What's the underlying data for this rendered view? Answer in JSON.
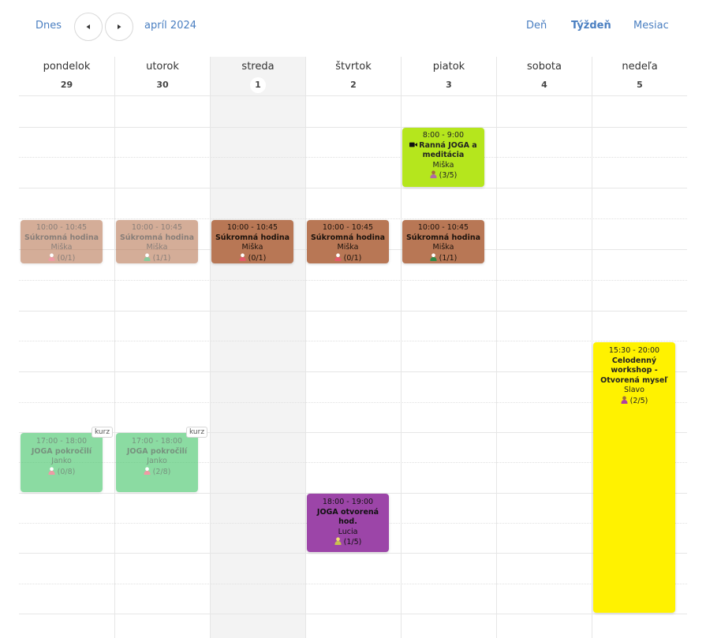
{
  "toolbar": {
    "today_label": "Dnes",
    "period_label": "apríl 2024",
    "views": {
      "day": "Deň",
      "week": "Týždeň",
      "month": "Mesiac"
    },
    "active_view": "week"
  },
  "days": [
    {
      "name": "pondelok",
      "number": "29"
    },
    {
      "name": "utorok",
      "number": "30"
    },
    {
      "name": "streda",
      "number": "1"
    },
    {
      "name": "štvrtok",
      "number": "2"
    },
    {
      "name": "piatok",
      "number": "3"
    },
    {
      "name": "sobota",
      "number": "4"
    },
    {
      "name": "nedeľa",
      "number": "5"
    }
  ],
  "events": {
    "mon_private": {
      "time": "10:00 - 10:45",
      "title": "Súkromná hodina",
      "teacher": "Miška",
      "capacity": "(0/1)"
    },
    "tue_private": {
      "time": "10:00 - 10:45",
      "title": "Súkromná hodina",
      "teacher": "Miška",
      "capacity": "(1/1)"
    },
    "wed_private": {
      "time": "10:00 - 10:45",
      "title": "Súkromná hodina",
      "teacher": "Miška",
      "capacity": "(0/1)"
    },
    "thu_private": {
      "time": "10:00 - 10:45",
      "title": "Súkromná hodina",
      "teacher": "Miška",
      "capacity": "(0/1)"
    },
    "fri_private": {
      "time": "10:00 - 10:45",
      "title": "Súkromná hodina",
      "teacher": "Miška",
      "capacity": "(1/1)"
    },
    "fri_morning": {
      "time": "8:00 - 9:00",
      "title": "Ranná JOGA a meditácia",
      "teacher": "Miška",
      "capacity": "(3/5)"
    },
    "mon_advanced": {
      "time": "17:00 - 18:00",
      "title": "JOGA pokročilí",
      "teacher": "Janko",
      "capacity": "(0/8)",
      "badge": "kurz"
    },
    "tue_advanced": {
      "time": "17:00 - 18:00",
      "title": "JOGA pokročilí",
      "teacher": "Janko",
      "capacity": "(2/8)",
      "badge": "kurz"
    },
    "thu_open": {
      "time": "18:00 - 19:00",
      "title": "JOGA otvorená hod.",
      "teacher": "Lucia",
      "capacity": "(1/5)"
    },
    "sun_workshop": {
      "time": "15:30 - 20:00",
      "title": "Celodenný workshop - Otvorená myseľ",
      "teacher": "Slavo",
      "capacity": "(2/5)"
    }
  },
  "colors": {
    "link": "#4a7fc1",
    "private": "#b87755",
    "morning": "#b5e61d",
    "advanced": "#86dfa0",
    "open_class": "#9c45a8",
    "workshop": "#fff200",
    "today_column": "#f3f3f3"
  }
}
